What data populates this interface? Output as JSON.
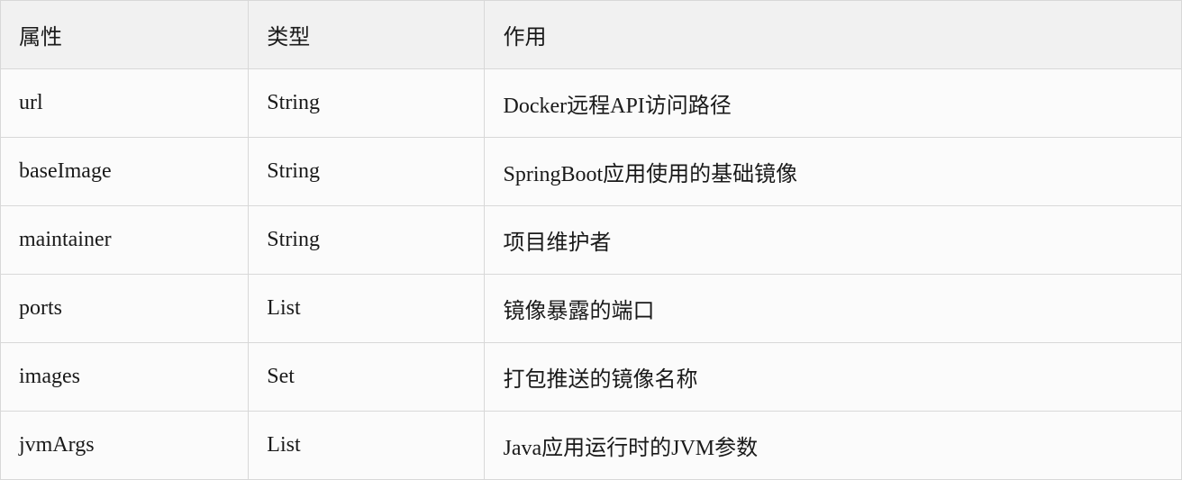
{
  "table": {
    "headers": [
      "属性",
      "类型",
      "作用"
    ],
    "rows": [
      {
        "attr": "url",
        "type": "String",
        "desc": "Docker远程API访问路径"
      },
      {
        "attr": "baseImage",
        "type": "String",
        "desc": "SpringBoot应用使用的基础镜像"
      },
      {
        "attr": "maintainer",
        "type": "String",
        "desc": "项目维护者"
      },
      {
        "attr": "ports",
        "type": "List",
        "desc": "镜像暴露的端口"
      },
      {
        "attr": "images",
        "type": "Set",
        "desc": "打包推送的镜像名称"
      },
      {
        "attr": "jvmArgs",
        "type": "List",
        "desc": "Java应用运行时的JVM参数"
      }
    ]
  }
}
